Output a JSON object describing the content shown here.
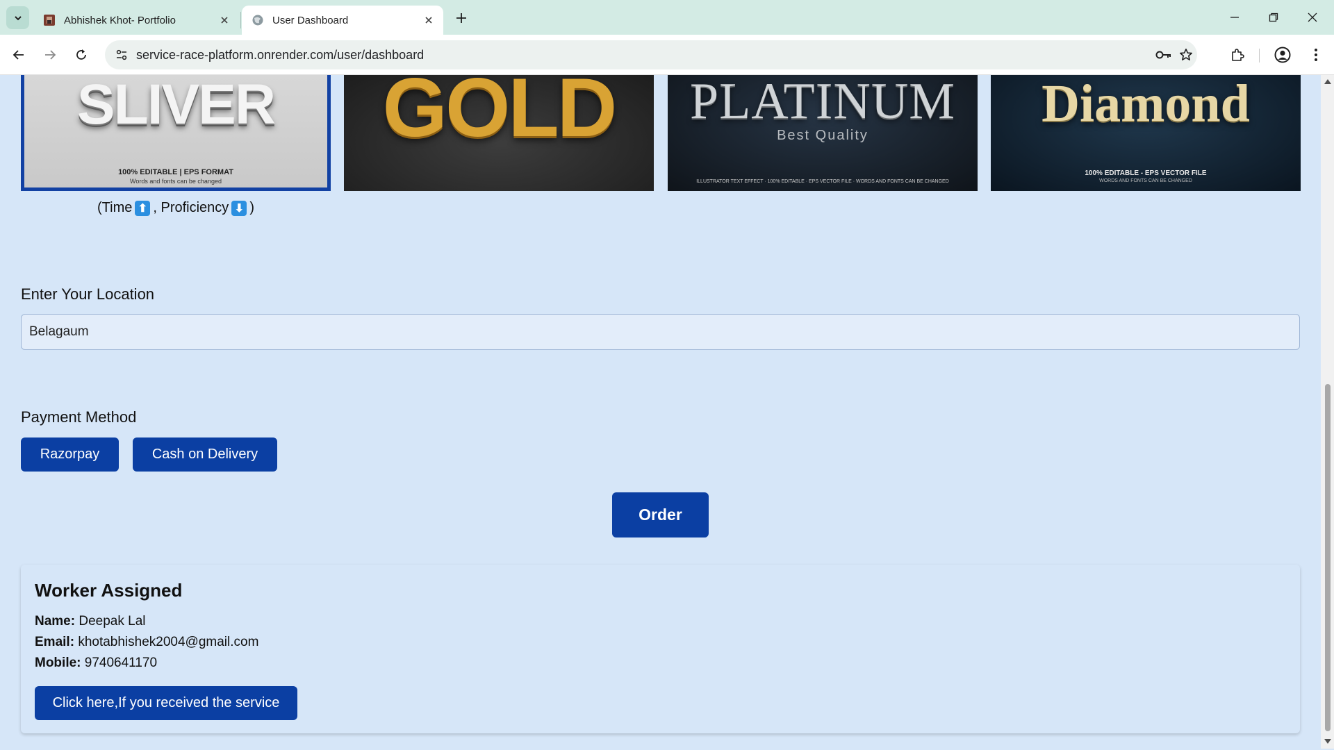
{
  "browser": {
    "tabs": [
      {
        "title": "Abhishek Khot- Portfolio",
        "active": false
      },
      {
        "title": "User Dashboard",
        "active": true
      }
    ],
    "url": "service-race-platform.onrender.com/user/dashboard"
  },
  "plans": [
    {
      "word": "SLIVER",
      "tag1": "100% EDITABLE | EPS FORMAT",
      "tag2": "Words and fonts can be changed",
      "selected": true
    },
    {
      "word": "GOLD",
      "selected": false
    },
    {
      "word": "PLATINUM",
      "sub": "Best Quality",
      "tag": "ILLUSTRATOR TEXT EFFECT · 100% EDITABLE · EPS VECTOR FILE · WORDS AND FONTS CAN BE CHANGED",
      "selected": false
    },
    {
      "word": "Diamond",
      "tag1": "100% EDITABLE - EPS VECTOR FILE",
      "tag2": "WORDS AND FONTS CAN BE CHANGED",
      "selected": false
    }
  ],
  "plan_legend": {
    "open": "(Time",
    "up_emoji": "⬆",
    "middle": ", Proficiency",
    "down_emoji": "⬇",
    "close": ")"
  },
  "location": {
    "label": "Enter Your Location",
    "value": "Belagaum"
  },
  "payment": {
    "label": "Payment Method",
    "options": [
      "Razorpay",
      "Cash on Delivery"
    ]
  },
  "order_button": "Order",
  "worker": {
    "title": "Worker Assigned",
    "name_label": "Name:",
    "name": "Deepak Lal",
    "email_label": "Email:",
    "email": "khotabhishek2004@gmail.com",
    "mobile_label": "Mobile:",
    "mobile": "9740641170",
    "received_button": "Click here,If you received the service"
  },
  "colors": {
    "page_bg": "#d6e6f8",
    "primary_button": "#0b3fa3",
    "tabbar_bg": "#d3ebe4"
  }
}
